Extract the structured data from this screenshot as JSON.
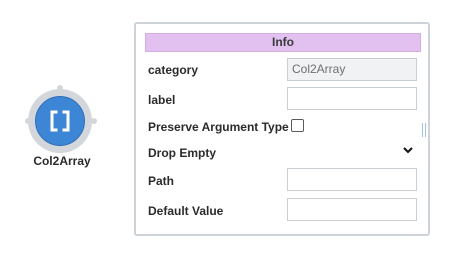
{
  "node": {
    "label": "Col2Array",
    "icon": "brackets-icon",
    "color": "#3d86d6"
  },
  "panel": {
    "title": "Info",
    "header_color": "#e2c0f0",
    "fields": {
      "category": {
        "label": "category",
        "value": "Col2Array"
      },
      "label": {
        "label": "label",
        "value": ""
      },
      "preserve_argument_type": {
        "label": "Preserve Argument Type",
        "checked": false
      },
      "drop_empty": {
        "label": "Drop Empty",
        "selected": ""
      },
      "path": {
        "label": "Path",
        "value": ""
      },
      "default_value": {
        "label": "Default Value",
        "value": ""
      }
    }
  }
}
